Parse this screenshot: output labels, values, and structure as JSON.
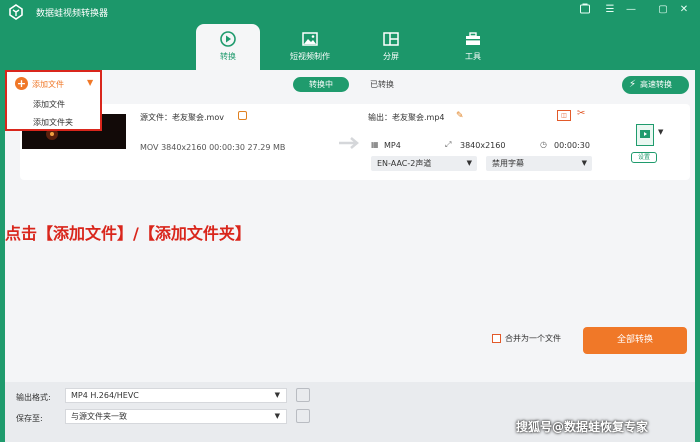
{
  "window": {
    "title": "数据蛙视频转换器",
    "controls": [
      "shop-icon",
      "menu-icon",
      "minimize-icon",
      "maximize-icon",
      "close-icon"
    ]
  },
  "main_tabs": [
    {
      "label": "转换",
      "icon": "convert-icon",
      "active": true
    },
    {
      "label": "短视频制作",
      "icon": "image-icon",
      "active": false
    },
    {
      "label": "分屏",
      "icon": "split-screen-icon",
      "active": false
    },
    {
      "label": "工具",
      "icon": "toolbox-icon",
      "active": false
    }
  ],
  "toolbar": {
    "add_file_label": "添加文件",
    "add_menu": [
      "添加文件",
      "添加文件夹"
    ],
    "seg_converting": "转换中",
    "seg_converted": "已转换",
    "fast_convert": "高速转换"
  },
  "file_card": {
    "source_label": "源文件：老友聚会.mov",
    "source_meta": "MOV   3840x2160   00:00:30   27.29 MB",
    "output_label": "输出：老友聚会.mp4",
    "output_format": "MP4",
    "output_resolution": "3840x2160",
    "output_duration": "00:00:30",
    "audio_track": "EN-AAC-2声道",
    "subtitle": "禁用字幕",
    "settings_label": "设置"
  },
  "annotation": "点击【添加文件】/【添加文件夹】",
  "footer": {
    "output_format_label": "输出格式:",
    "output_format_value": "MP4 H.264/HEVC",
    "save_to_label": "保存至:",
    "save_to_value": "与源文件夹一致",
    "merge_label": "合并为一个文件",
    "convert_all": "全部转换"
  },
  "watermark": "搜狐号@数据蛙恢复专家",
  "colors": {
    "brand_green": "#1f9b6d",
    "accent_orange": "#f07828",
    "highlight_red": "#d9261c"
  }
}
